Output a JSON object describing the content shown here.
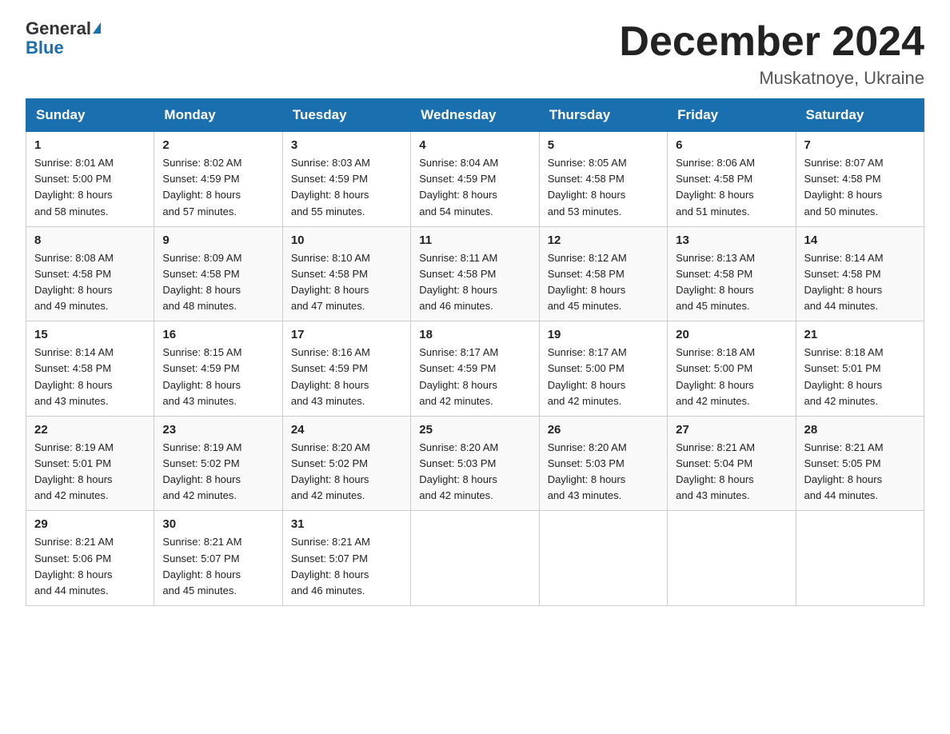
{
  "logo": {
    "general": "General",
    "triangle": "▶",
    "blue": "Blue"
  },
  "title": "December 2024",
  "location": "Muskatnoye, Ukraine",
  "days_of_week": [
    "Sunday",
    "Monday",
    "Tuesday",
    "Wednesday",
    "Thursday",
    "Friday",
    "Saturday"
  ],
  "weeks": [
    [
      {
        "day": "1",
        "info": "Sunrise: 8:01 AM\nSunset: 5:00 PM\nDaylight: 8 hours\nand 58 minutes."
      },
      {
        "day": "2",
        "info": "Sunrise: 8:02 AM\nSunset: 4:59 PM\nDaylight: 8 hours\nand 57 minutes."
      },
      {
        "day": "3",
        "info": "Sunrise: 8:03 AM\nSunset: 4:59 PM\nDaylight: 8 hours\nand 55 minutes."
      },
      {
        "day": "4",
        "info": "Sunrise: 8:04 AM\nSunset: 4:59 PM\nDaylight: 8 hours\nand 54 minutes."
      },
      {
        "day": "5",
        "info": "Sunrise: 8:05 AM\nSunset: 4:58 PM\nDaylight: 8 hours\nand 53 minutes."
      },
      {
        "day": "6",
        "info": "Sunrise: 8:06 AM\nSunset: 4:58 PM\nDaylight: 8 hours\nand 51 minutes."
      },
      {
        "day": "7",
        "info": "Sunrise: 8:07 AM\nSunset: 4:58 PM\nDaylight: 8 hours\nand 50 minutes."
      }
    ],
    [
      {
        "day": "8",
        "info": "Sunrise: 8:08 AM\nSunset: 4:58 PM\nDaylight: 8 hours\nand 49 minutes."
      },
      {
        "day": "9",
        "info": "Sunrise: 8:09 AM\nSunset: 4:58 PM\nDaylight: 8 hours\nand 48 minutes."
      },
      {
        "day": "10",
        "info": "Sunrise: 8:10 AM\nSunset: 4:58 PM\nDaylight: 8 hours\nand 47 minutes."
      },
      {
        "day": "11",
        "info": "Sunrise: 8:11 AM\nSunset: 4:58 PM\nDaylight: 8 hours\nand 46 minutes."
      },
      {
        "day": "12",
        "info": "Sunrise: 8:12 AM\nSunset: 4:58 PM\nDaylight: 8 hours\nand 45 minutes."
      },
      {
        "day": "13",
        "info": "Sunrise: 8:13 AM\nSunset: 4:58 PM\nDaylight: 8 hours\nand 45 minutes."
      },
      {
        "day": "14",
        "info": "Sunrise: 8:14 AM\nSunset: 4:58 PM\nDaylight: 8 hours\nand 44 minutes."
      }
    ],
    [
      {
        "day": "15",
        "info": "Sunrise: 8:14 AM\nSunset: 4:58 PM\nDaylight: 8 hours\nand 43 minutes."
      },
      {
        "day": "16",
        "info": "Sunrise: 8:15 AM\nSunset: 4:59 PM\nDaylight: 8 hours\nand 43 minutes."
      },
      {
        "day": "17",
        "info": "Sunrise: 8:16 AM\nSunset: 4:59 PM\nDaylight: 8 hours\nand 43 minutes."
      },
      {
        "day": "18",
        "info": "Sunrise: 8:17 AM\nSunset: 4:59 PM\nDaylight: 8 hours\nand 42 minutes."
      },
      {
        "day": "19",
        "info": "Sunrise: 8:17 AM\nSunset: 5:00 PM\nDaylight: 8 hours\nand 42 minutes."
      },
      {
        "day": "20",
        "info": "Sunrise: 8:18 AM\nSunset: 5:00 PM\nDaylight: 8 hours\nand 42 minutes."
      },
      {
        "day": "21",
        "info": "Sunrise: 8:18 AM\nSunset: 5:01 PM\nDaylight: 8 hours\nand 42 minutes."
      }
    ],
    [
      {
        "day": "22",
        "info": "Sunrise: 8:19 AM\nSunset: 5:01 PM\nDaylight: 8 hours\nand 42 minutes."
      },
      {
        "day": "23",
        "info": "Sunrise: 8:19 AM\nSunset: 5:02 PM\nDaylight: 8 hours\nand 42 minutes."
      },
      {
        "day": "24",
        "info": "Sunrise: 8:20 AM\nSunset: 5:02 PM\nDaylight: 8 hours\nand 42 minutes."
      },
      {
        "day": "25",
        "info": "Sunrise: 8:20 AM\nSunset: 5:03 PM\nDaylight: 8 hours\nand 42 minutes."
      },
      {
        "day": "26",
        "info": "Sunrise: 8:20 AM\nSunset: 5:03 PM\nDaylight: 8 hours\nand 43 minutes."
      },
      {
        "day": "27",
        "info": "Sunrise: 8:21 AM\nSunset: 5:04 PM\nDaylight: 8 hours\nand 43 minutes."
      },
      {
        "day": "28",
        "info": "Sunrise: 8:21 AM\nSunset: 5:05 PM\nDaylight: 8 hours\nand 44 minutes."
      }
    ],
    [
      {
        "day": "29",
        "info": "Sunrise: 8:21 AM\nSunset: 5:06 PM\nDaylight: 8 hours\nand 44 minutes."
      },
      {
        "day": "30",
        "info": "Sunrise: 8:21 AM\nSunset: 5:07 PM\nDaylight: 8 hours\nand 45 minutes."
      },
      {
        "day": "31",
        "info": "Sunrise: 8:21 AM\nSunset: 5:07 PM\nDaylight: 8 hours\nand 46 minutes."
      },
      null,
      null,
      null,
      null
    ]
  ]
}
